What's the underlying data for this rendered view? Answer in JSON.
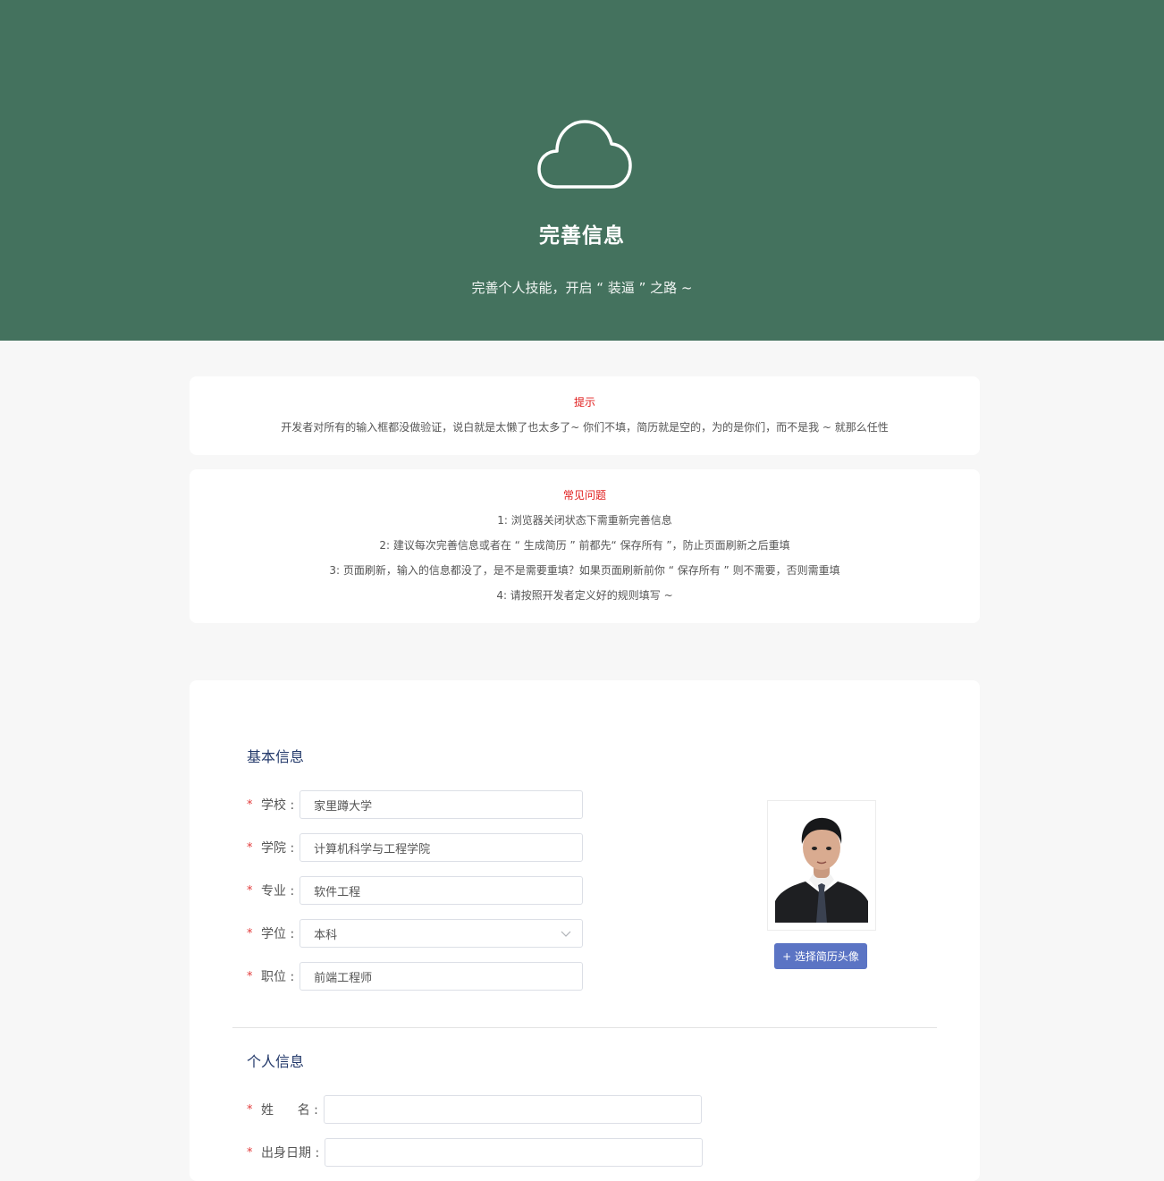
{
  "hero": {
    "title": "完善信息",
    "subtitle": "完善个人技能，开启 “ 装逼 ” 之路 ~",
    "icon": "cloud-icon",
    "background": "#44725e"
  },
  "tip": {
    "title": "提示",
    "text": "开发者对所有的输入框都没做验证，说白就是太懒了也太多了~ 你们不填，简历就是空的，为的是你们，而不是我 ~ 就那么任性"
  },
  "faq": {
    "title": "常见问题",
    "items": [
      "1: 浏览器关闭状态下需重新完善信息",
      "2: 建议每次完善信息或者在 “ 生成简历 ” 前都先“ 保存所有 ”，防止页面刷新之后重填",
      "3: 页面刷新，输入的信息都没了，是不是需要重填？如果页面刷新前你 “ 保存所有 ” 则不需要，否则需重填",
      "4: 请按照开发者定义好的规则填写 ~"
    ]
  },
  "basic": {
    "title": "基本信息",
    "required_mark": "*",
    "fields": [
      {
        "label": "学校 :",
        "value": "家里蹲大学"
      },
      {
        "label": "学院 :",
        "value": "计算机科学与工程学院"
      },
      {
        "label": "专业 :",
        "value": "软件工程"
      },
      {
        "label": "学位 :",
        "value": "本科"
      },
      {
        "label": "职位 :",
        "value": "前端工程师"
      }
    ],
    "avatar_button": "+ 选择简历头像"
  },
  "personal": {
    "title": "个人信息",
    "fields": [
      {
        "label": "姓      名 :",
        "value": ""
      },
      {
        "label": "出身日期 :",
        "value": ""
      }
    ]
  },
  "colors": {
    "accent": "#5b74c4",
    "required": "#e23b3b",
    "notice": "#e01b1b",
    "section_title": "#243a6b"
  }
}
